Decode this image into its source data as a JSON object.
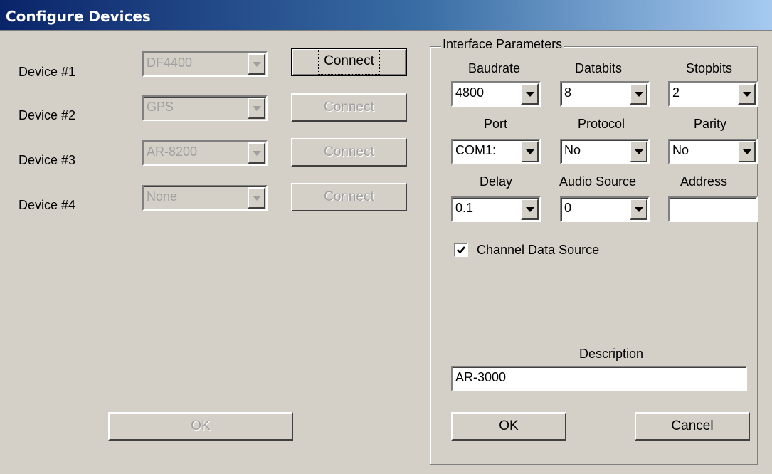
{
  "window": {
    "title": "Configure Devices"
  },
  "devices": [
    {
      "label": "Device #1",
      "value": "DF4400",
      "connect": "Connect"
    },
    {
      "label": "Device #2",
      "value": "GPS",
      "connect": "Connect"
    },
    {
      "label": "Device #3",
      "value": "AR-8200",
      "connect": "Connect"
    },
    {
      "label": "Device #4",
      "value": "None",
      "connect": "Connect"
    }
  ],
  "left_ok": "OK",
  "interface": {
    "legend": "Interface Parameters",
    "baudrate": {
      "label": "Baudrate",
      "value": "4800"
    },
    "databits": {
      "label": "Databits",
      "value": "8"
    },
    "stopbits": {
      "label": "Stopbits",
      "value": "2"
    },
    "port": {
      "label": "Port",
      "value": "COM1:"
    },
    "protocol": {
      "label": "Protocol",
      "value": "No"
    },
    "parity": {
      "label": "Parity",
      "value": "No"
    },
    "delay": {
      "label": "Delay",
      "value": "0.1"
    },
    "audio_source": {
      "label": "Audio Source",
      "value": "0"
    },
    "address": {
      "label": "Address",
      "value": ""
    },
    "channel_data_source": {
      "label": "Channel Data Source",
      "checked": true
    },
    "description": {
      "label": "Description",
      "value": "AR-3000"
    },
    "ok": "OK",
    "cancel": "Cancel"
  }
}
